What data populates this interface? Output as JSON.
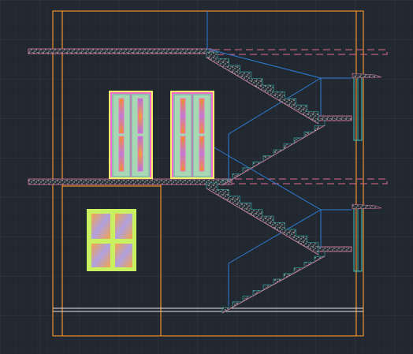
{
  "canvas": {
    "background": "#212830",
    "grid_on": true,
    "grid_minor_color": "#2a323c",
    "grid_major_color": "#333c47"
  },
  "colors": {
    "wall_outline": "#f0902a",
    "stair_outline": "#2f7dd6",
    "stair_fill": "#2a8a8a",
    "concrete_slab": "#c8c8c8",
    "slab_edge": "#e07aa0",
    "hidden_line": "#e06a8a",
    "door_frame": "#f06ad0",
    "door_fill": "#a7d7b3",
    "door_glass_orange": "#f28f2e",
    "door_glass_purple": "#b070e0",
    "window_frame": "#c8f060",
    "window_glass_orange": "#f2a44a",
    "window_glass_blue": "#9aa8e8",
    "railing": "#40c8c0",
    "baseline": "#e6e6e6"
  },
  "elements": {
    "doors": [
      {
        "name": "left-door",
        "leaves": 2
      },
      {
        "name": "right-door",
        "leaves": 2
      }
    ],
    "window": {
      "name": "window",
      "panes": 4
    },
    "stair_flights": [
      {
        "name": "upper-flight-a",
        "steps": 10
      },
      {
        "name": "upper-flight-b",
        "steps": 10
      },
      {
        "name": "lower-flight-a",
        "steps": 10
      },
      {
        "name": "lower-flight-b",
        "steps": 10
      }
    ],
    "floor_slabs": [
      "upper-slab",
      "middle-slab"
    ]
  }
}
